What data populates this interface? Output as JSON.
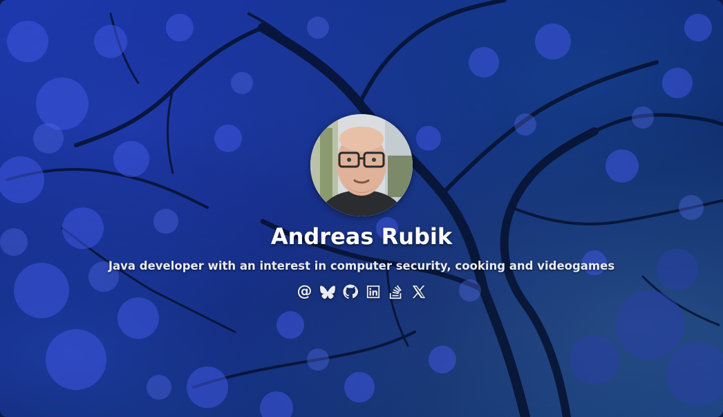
{
  "profile": {
    "name": "Andreas Rubik",
    "tagline": "Java developer with an interest in computer security, cooking and videogames"
  },
  "socials": [
    {
      "icon": "at-icon",
      "glyph": "@"
    },
    {
      "icon": "bluesky-icon"
    },
    {
      "icon": "github-icon"
    },
    {
      "icon": "linkedin-icon"
    },
    {
      "icon": "stackoverflow-icon"
    },
    {
      "icon": "x-icon"
    }
  ],
  "colors": {
    "background": "#0f2575",
    "text": "#ffffff",
    "icon": "#e9ecf3"
  }
}
